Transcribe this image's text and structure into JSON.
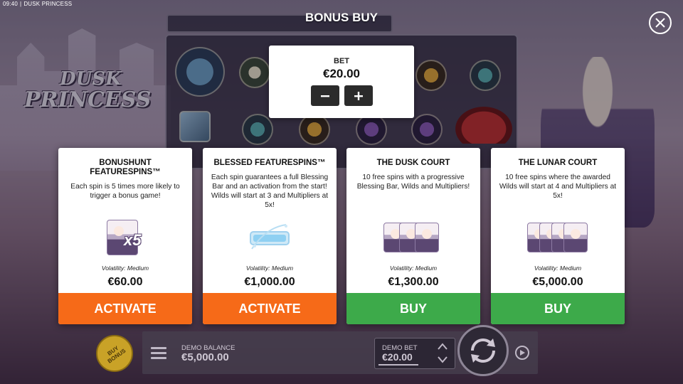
{
  "status_bar": {
    "time": "09:40",
    "game_name": "DUSK PRINCESS"
  },
  "logo": {
    "line1": "DUSK",
    "line2": "PRINCESS"
  },
  "header": {
    "title": "BONUS BUY"
  },
  "bet": {
    "label": "BET",
    "value": "€20.00",
    "decrease_icon": "minus-icon",
    "increase_icon": "plus-icon"
  },
  "cards": [
    {
      "title": "BONUSHUNT FEATURESPINS™",
      "description": "Each spin is 5 times more likely to trigger a bonus game!",
      "art_badge": "x5",
      "volatility": "Volatility: Medium",
      "price": "€60.00",
      "action": "ACTIVATE",
      "action_color": "#f66a18"
    },
    {
      "title": "BLESSED FEATURESPINS™",
      "description": "Each spin guarantees a full Blessing Bar and an activation from the start! Wilds will start at 3 and Multipliers at 5x!",
      "volatility": "Volatility: Medium",
      "price": "€1,000.00",
      "action": "ACTIVATE",
      "action_color": "#f66a18"
    },
    {
      "title": "THE DUSK COURT",
      "description": "10 free spins with a progressive Blessing Bar, Wilds and Multipliers!",
      "volatility": "Volatility: Medium",
      "price": "€1,300.00",
      "action": "BUY",
      "action_color": "#3daa4a"
    },
    {
      "title": "THE LUNAR COURT",
      "description": "10 free spins where the awarded Wilds will start at 4 and Multipliers at 5x!",
      "volatility": "Volatility: Medium",
      "price": "€5,000.00",
      "action": "BUY",
      "action_color": "#3daa4a"
    }
  ],
  "bottom_bar": {
    "buy_bonus_line1": "BUY",
    "buy_bonus_line2": "BONUS",
    "balance_label": "DEMO BALANCE",
    "balance_value": "€5,000.00",
    "bet_label": "DEMO BET",
    "bet_value": "€20.00"
  }
}
